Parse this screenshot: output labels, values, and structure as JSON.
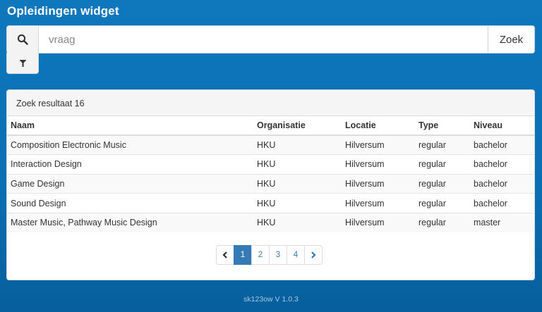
{
  "header": {
    "title": "Opleidingen widget"
  },
  "search": {
    "placeholder": "vraag",
    "value": "",
    "button_label": "Zoek"
  },
  "results": {
    "heading": "Zoek resultaat 16",
    "columns": [
      "Naam",
      "Organisatie",
      "Locatie",
      "Type",
      "Niveau"
    ],
    "rows": [
      [
        "Composition Electronic Music",
        "HKU",
        "Hilversum",
        "regular",
        "bachelor"
      ],
      [
        "Interaction Design",
        "HKU",
        "Hilversum",
        "regular",
        "bachelor"
      ],
      [
        "Game Design",
        "HKU",
        "Hilversum",
        "regular",
        "bachelor"
      ],
      [
        "Sound Design",
        "HKU",
        "Hilversum",
        "regular",
        "bachelor"
      ],
      [
        "Master Music, Pathway Music Design",
        "HKU",
        "Hilversum",
        "regular",
        "master"
      ]
    ]
  },
  "pagination": {
    "pages": [
      "1",
      "2",
      "3",
      "4"
    ],
    "active_page": "1"
  },
  "footer": {
    "version": "sk123ow V 1.0.3"
  },
  "colors": {
    "background": "#0a6eb3",
    "accent": "#337ab7"
  },
  "icons": {
    "search": "search-icon",
    "filter": "filter-icon",
    "prev": "chevron-left-icon",
    "next": "chevron-right-icon"
  }
}
